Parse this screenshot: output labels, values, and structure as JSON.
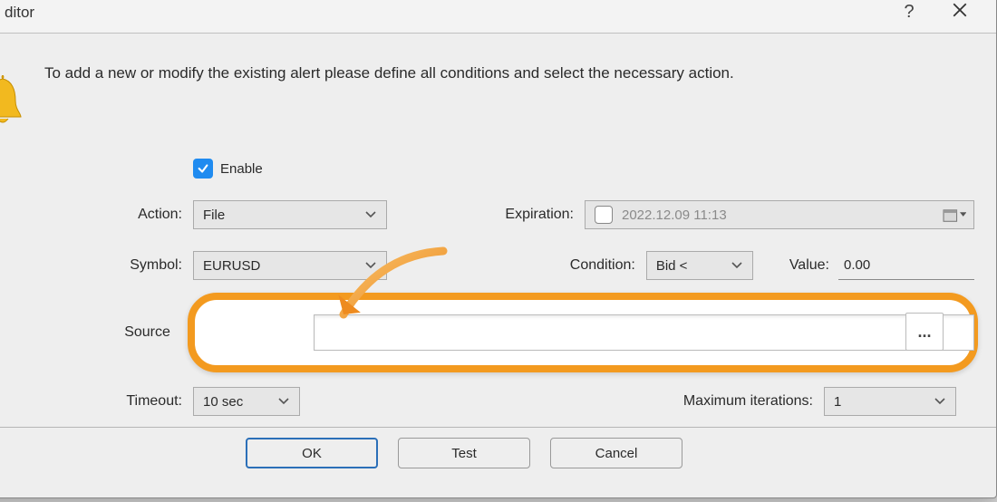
{
  "window": {
    "title": "ditor"
  },
  "hero": {
    "text": "To add a new or modify the existing alert please define all conditions and select the necessary action."
  },
  "form": {
    "enable_label": "Enable",
    "enable_checked": true,
    "action": {
      "label": "Action:",
      "value": "File"
    },
    "expiration": {
      "label": "Expiration:",
      "value": "2022.12.09 11:13"
    },
    "symbol": {
      "label": "Symbol:",
      "value": "EURUSD"
    },
    "condition": {
      "label": "Condition:",
      "value": "Bid <"
    },
    "valueField": {
      "label": "Value:",
      "value": "0.00"
    },
    "source": {
      "label": "Source",
      "value": "",
      "browse": "..."
    },
    "timeout": {
      "label": "Timeout:",
      "value": "10 sec"
    },
    "max_iterations": {
      "label": "Maximum iterations:",
      "value": "1"
    }
  },
  "buttons": {
    "ok": "OK",
    "test": "Test",
    "cancel": "Cancel"
  }
}
